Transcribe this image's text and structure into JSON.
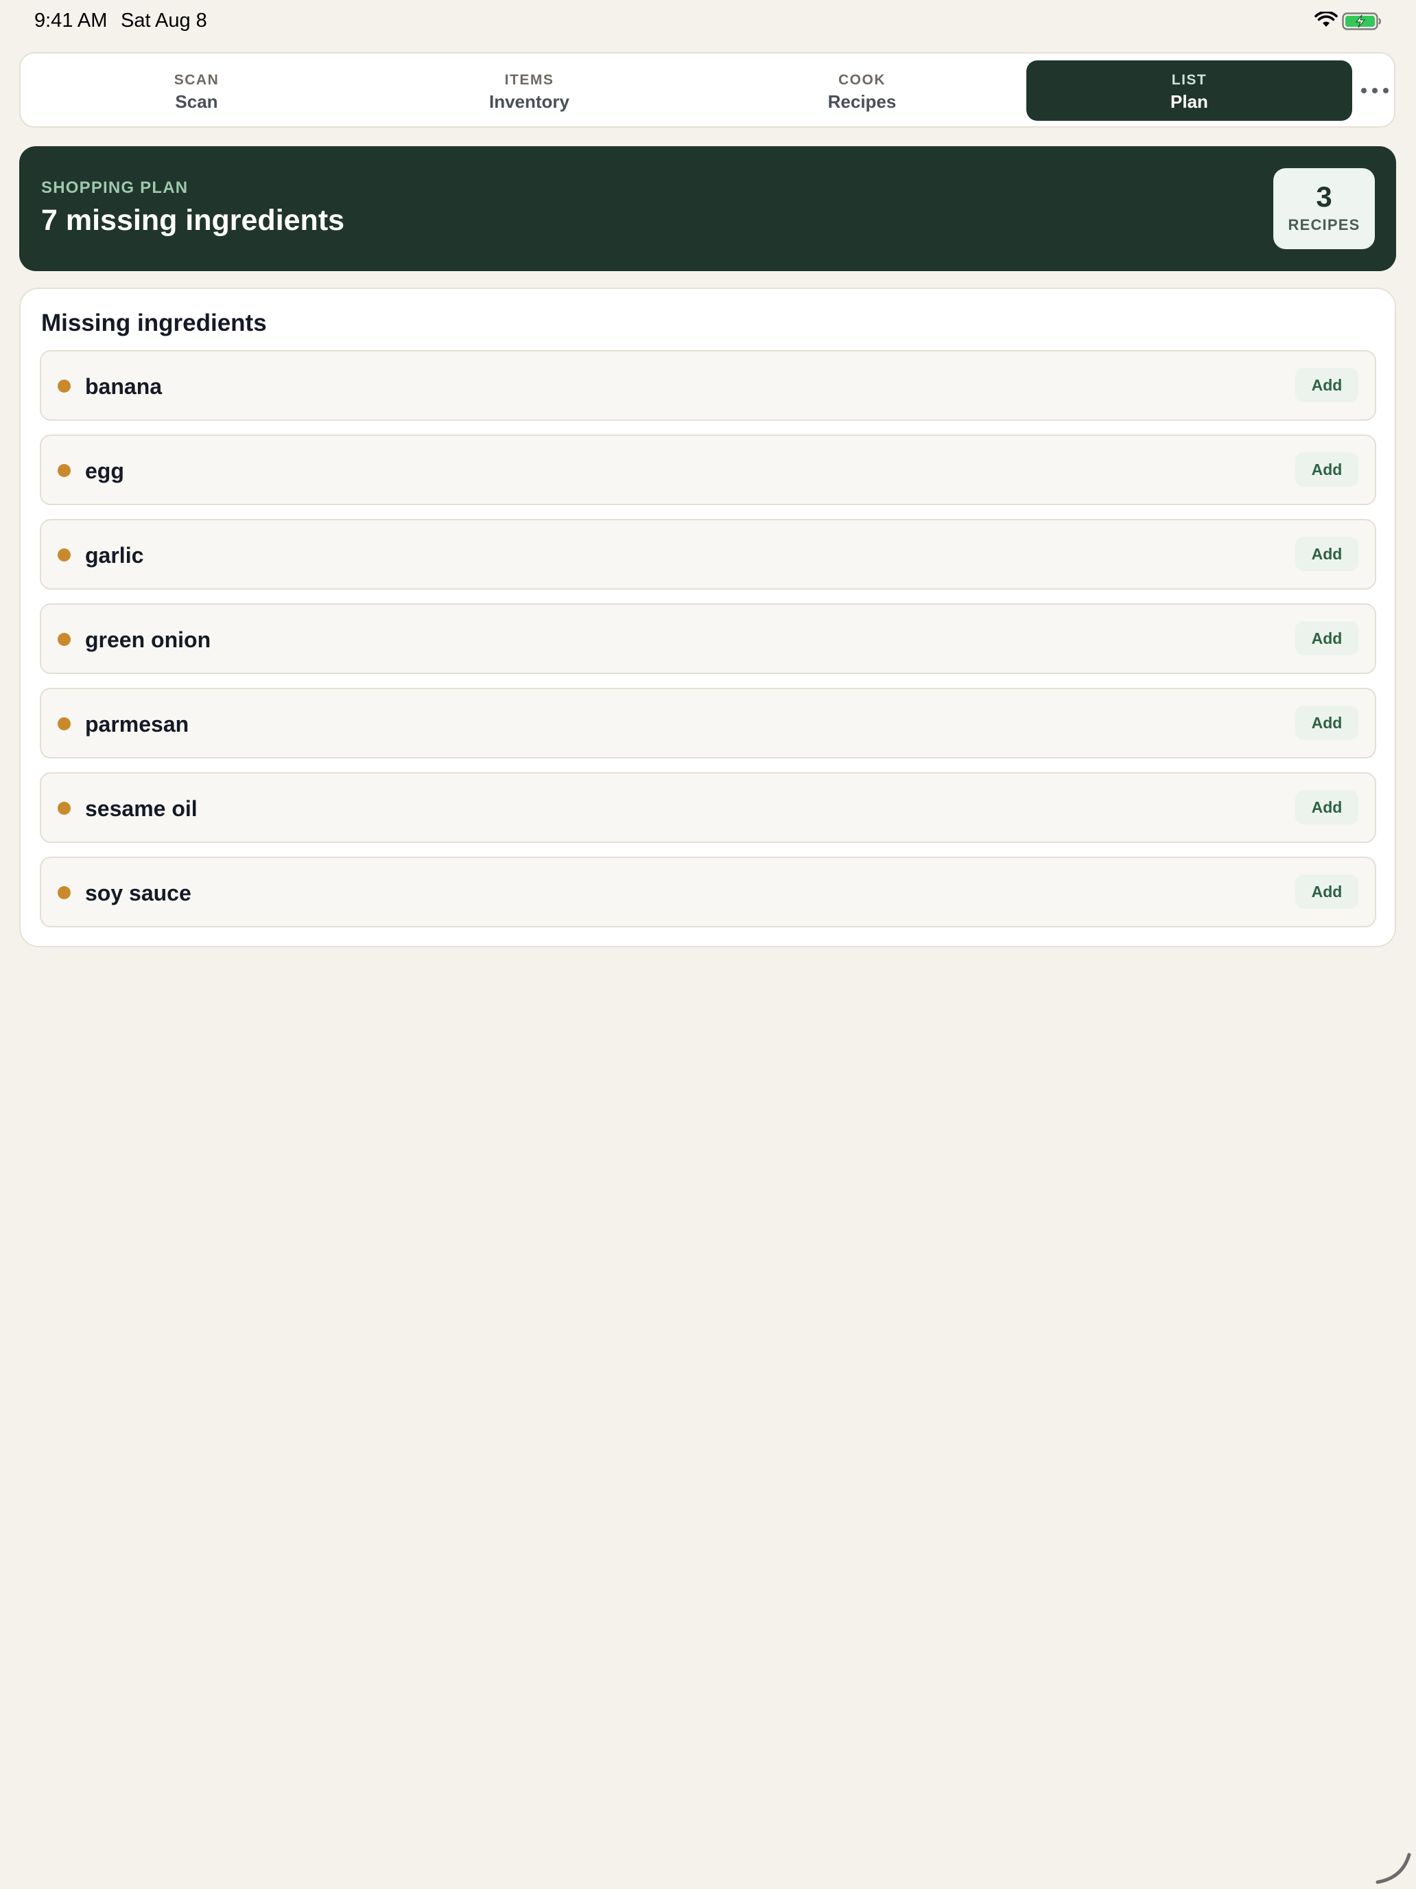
{
  "status_bar": {
    "time": "9:41 AM",
    "date": "Sat Aug 8",
    "battery_color": "#34c759"
  },
  "tabs": [
    {
      "kicker": "SCAN",
      "label": "Scan",
      "active": false
    },
    {
      "kicker": "ITEMS",
      "label": "Inventory",
      "active": false
    },
    {
      "kicker": "COOK",
      "label": "Recipes",
      "active": false
    },
    {
      "kicker": "LIST",
      "label": "Plan",
      "active": true
    }
  ],
  "more_icon": "ellipsis-icon",
  "hero": {
    "kicker": "SHOPPING PLAN",
    "title": "7 missing ingredients",
    "recipes_count": "3",
    "recipes_label": "RECIPES",
    "background_color": "#20352c"
  },
  "missing": {
    "title": "Missing ingredients",
    "add_label": "Add",
    "dot_color": "#c98a2e",
    "items": [
      {
        "name": "banana"
      },
      {
        "name": "egg"
      },
      {
        "name": "garlic"
      },
      {
        "name": "green onion"
      },
      {
        "name": "parmesan"
      },
      {
        "name": "sesame oil"
      },
      {
        "name": "soy sauce"
      }
    ]
  }
}
